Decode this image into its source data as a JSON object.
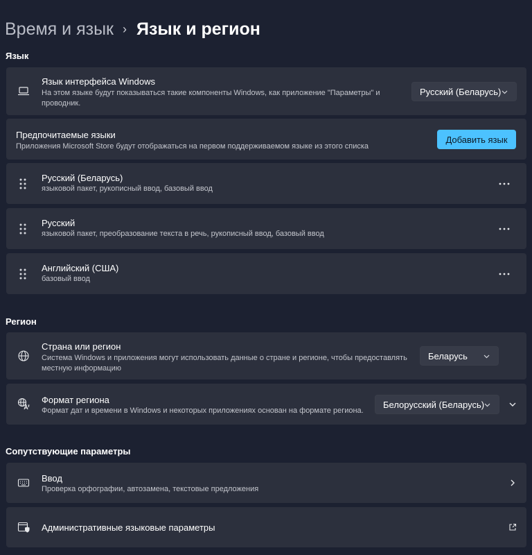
{
  "breadcrumb": {
    "parent": "Время и язык",
    "separator": "›",
    "current": "Язык и регион"
  },
  "language_section": {
    "title": "Язык",
    "display_language": {
      "icon": "laptop-icon",
      "title": "Язык интерфейса Windows",
      "description": "На этом языке будут показываться такие компоненты Windows, как приложение \"Параметры\" и проводник.",
      "selected": "Русский (Беларусь)"
    },
    "preferred": {
      "title": "Предпочитаемые языки",
      "description": "Приложения Microsoft Store будут отображаться на первом поддерживаемом языке из этого списка",
      "add_button": "Добавить язык"
    },
    "languages": [
      {
        "name": "Русский (Беларусь)",
        "features": "языковой пакет, рукописный ввод, базовый ввод"
      },
      {
        "name": "Русский",
        "features": "языковой пакет, преобразование текста в речь, рукописный ввод, базовый ввод"
      },
      {
        "name": "Английский (США)",
        "features": "базовый ввод"
      }
    ]
  },
  "region_section": {
    "title": "Регион",
    "country": {
      "icon": "globe-icon",
      "title": "Страна или регион",
      "description": "Система Windows и приложения могут использовать данные о стране и регионе, чтобы предоставлять местную информацию",
      "selected": "Беларусь"
    },
    "format": {
      "icon": "regional-format-icon",
      "title": "Формат региона",
      "description": "Формат дат и времени в Windows и некоторых приложениях основан на формате региона.",
      "selected": "Белорусский (Беларусь)"
    }
  },
  "related_section": {
    "title": "Сопутствующие параметры",
    "typing": {
      "icon": "keyboard-icon",
      "title": "Ввод",
      "description": "Проверка орфографии, автозамена, текстовые предложения"
    },
    "admin": {
      "icon": "admin-language-icon",
      "title": "Административные языковые параметры"
    }
  },
  "colors": {
    "background": "#1c2131",
    "card": "#2c303d",
    "accent": "#4cc2ff"
  }
}
